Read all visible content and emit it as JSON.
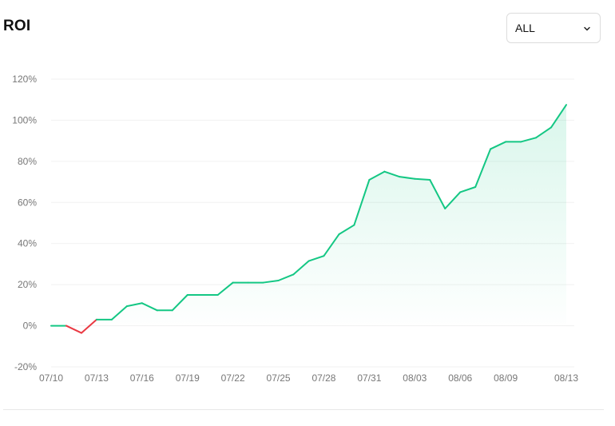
{
  "header": {
    "title": "ROI"
  },
  "range_select": {
    "value": "ALL",
    "icon": "chevron-down-icon"
  },
  "colors": {
    "positive": "#14c784",
    "negative": "#ea3943",
    "grid": "#f1f1f1",
    "tick_text": "#777777"
  },
  "chart_data": {
    "type": "area",
    "title": "ROI",
    "xlabel": "",
    "ylabel": "",
    "y_unit": "%",
    "ylim": [
      -20,
      120
    ],
    "y_ticks": [
      "120%",
      "100%",
      "80%",
      "60%",
      "40%",
      "20%",
      "0%",
      "-20%"
    ],
    "y_tick_values": [
      120,
      100,
      80,
      60,
      40,
      20,
      0,
      -20
    ],
    "x_ticks": [
      "07/10",
      "07/13",
      "07/16",
      "07/19",
      "07/22",
      "07/25",
      "07/28",
      "07/31",
      "08/03",
      "08/06",
      "08/09",
      "08/13"
    ],
    "x_tick_values": [
      "2024-07-10",
      "2024-07-13",
      "2024-07-16",
      "2024-07-19",
      "2024-07-22",
      "2024-07-25",
      "2024-07-28",
      "2024-07-31",
      "2024-08-03",
      "2024-08-06",
      "2024-08-09",
      "2024-08-13"
    ],
    "grid": true,
    "legend": "none",
    "series": [
      {
        "x": [
          "2024-07-10",
          "2024-07-11",
          "2024-07-12",
          "2024-07-13",
          "2024-07-14",
          "2024-07-15",
          "2024-07-16",
          "2024-07-17",
          "2024-07-18",
          "2024-07-19",
          "2024-07-20",
          "2024-07-21",
          "2024-07-22",
          "2024-07-23",
          "2024-07-24",
          "2024-07-25",
          "2024-07-26",
          "2024-07-27",
          "2024-07-28",
          "2024-07-29",
          "2024-07-30",
          "2024-07-31",
          "2024-08-01",
          "2024-08-02",
          "2024-08-03",
          "2024-08-04",
          "2024-08-05",
          "2024-08-06",
          "2024-08-07",
          "2024-08-08",
          "2024-08-09",
          "2024-08-10",
          "2024-08-11",
          "2024-08-12",
          "2024-08-13"
        ],
        "values": [
          0,
          0,
          -3.5,
          3,
          3,
          9.5,
          11,
          7.5,
          7.5,
          15,
          15,
          15,
          21,
          21,
          21,
          22,
          25,
          31.5,
          34,
          44.5,
          49,
          71,
          75,
          72.5,
          71.5,
          71,
          57,
          65,
          67.5,
          86,
          89.5,
          89.5,
          91.5,
          96.5,
          107.5
        ]
      }
    ]
  }
}
